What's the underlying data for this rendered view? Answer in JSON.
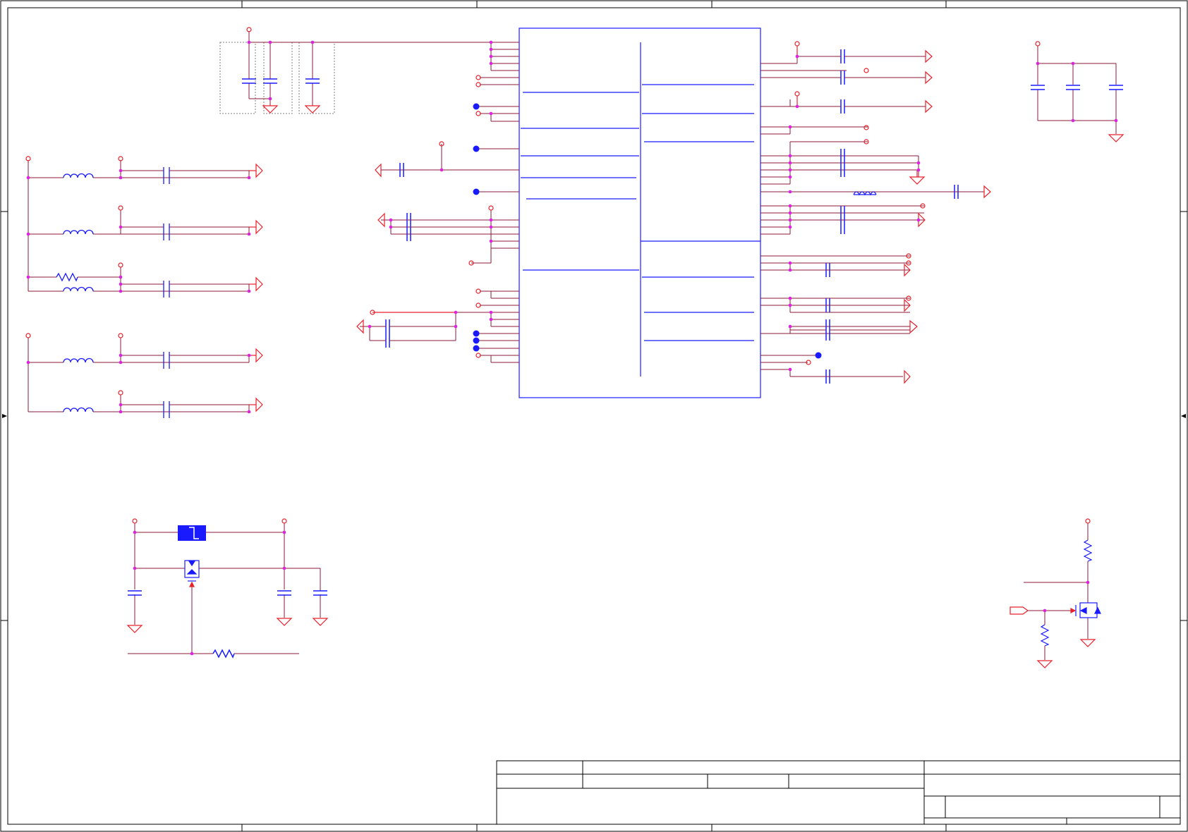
{
  "title_block": {},
  "colors": {
    "wire": "#8b1a3a",
    "component": "#e8202a",
    "junction": "#e020e0",
    "chip": "#1a1aff",
    "frame": "#000000",
    "outline": "#808080",
    "background": "#ffffff"
  },
  "icons": {
    "ground": "ground-icon",
    "power": "power-port-icon",
    "capacitor": "capacitor-icon",
    "inductor": "inductor-icon",
    "resistor": "resistor-icon",
    "mosfet": "mosfet-icon",
    "fuse": "fuse-icon",
    "connector": "connector-icon",
    "net_port": "net-port-icon"
  }
}
